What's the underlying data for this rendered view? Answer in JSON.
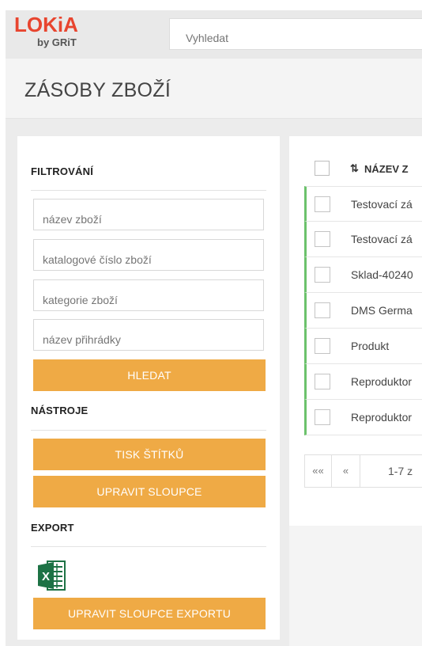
{
  "app": {
    "logo_text": "LOKiA",
    "logo_sub": "by GRiT",
    "search_placeholder": "Vyhledat"
  },
  "page": {
    "title": "ZÁSOBY ZBOŽÍ"
  },
  "filters": {
    "title": "FILTROVÁNÍ",
    "fields": [
      {
        "placeholder": "název zboží"
      },
      {
        "placeholder": "katalogové číslo zboží"
      },
      {
        "placeholder": "kategorie zboží"
      },
      {
        "placeholder": "název přihrádky"
      }
    ],
    "search_button": "HLEDAT"
  },
  "tools": {
    "title": "NÁSTROJE",
    "print_labels_button": "TISK ŠTÍTKŮ",
    "edit_columns_button": "UPRAVIT SLOUPCE"
  },
  "export": {
    "title": "EXPORT",
    "excel_icon": "excel-icon",
    "edit_export_columns_button": "UPRAVIT SLOUPCE EXPORTU"
  },
  "table": {
    "header": {
      "sort_icon": "⇅",
      "column_label": "NÁZEV Z"
    },
    "row_accent": "#6cc26c",
    "rows": [
      {
        "name": "Testovací zá"
      },
      {
        "name": "Testovací zá"
      },
      {
        "name": "Sklad-40240"
      },
      {
        "name": "DMS Germa"
      },
      {
        "name": "Produkt"
      },
      {
        "name": "Reproduktor"
      },
      {
        "name": "Reproduktor"
      }
    ]
  },
  "pagination": {
    "first": "««",
    "prev": "«",
    "info": "1-7 z"
  },
  "colors": {
    "accent": "#efaa45",
    "brand": "#e8452f",
    "excel_green": "#1d7245"
  }
}
